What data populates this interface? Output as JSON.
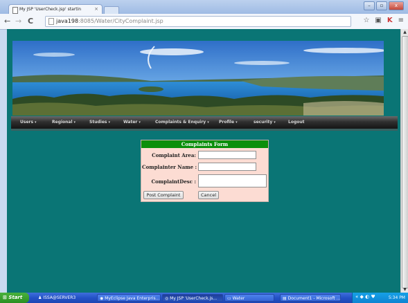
{
  "browser": {
    "tab_title": "My JSP 'UserCheck.jsp' startin",
    "tab_close": "×",
    "url_host": "java198",
    "url_rest": ":8085/Water/CityComplaint.jsp",
    "back": "←",
    "forward": "→",
    "reload": "C",
    "star": "☆",
    "menu": "≡",
    "win_min": "–",
    "win_max": "▫",
    "win_close": "x"
  },
  "nav": {
    "items": [
      {
        "label": "Users"
      },
      {
        "label": "Regional"
      },
      {
        "label": "Studies"
      },
      {
        "label": "Water"
      },
      {
        "label": "Complaints & Enquiry"
      },
      {
        "label": "Profile"
      },
      {
        "label": "security"
      },
      {
        "label": "Logout"
      }
    ],
    "caret": "▾"
  },
  "form": {
    "title": "Complaints Form",
    "area_label": "Complaint Area:",
    "area_value": "",
    "name_label": "Complainter Name :",
    "name_value": "",
    "desc_label": "ComplaintDesc :",
    "desc_value": "",
    "submit_label": "Post Complaint",
    "cancel_label": "Cancel"
  },
  "taskbar": {
    "start_label": "Start",
    "tasks": [
      {
        "label": "ISSA@SERVER3"
      },
      {
        "label": "MyEclipse Java Enterpris..."
      },
      {
        "label": "My JSP 'UserCheck.js..."
      },
      {
        "label": "Water"
      },
      {
        "label": "Document1 - Microsoft ..."
      }
    ],
    "clock": "5:34 PM"
  },
  "colors": {
    "page_bg": "#0a7575",
    "form_header": "#0b8f0b",
    "form_bg": "#fcdcd3",
    "navbar": "#1e1e1e"
  }
}
